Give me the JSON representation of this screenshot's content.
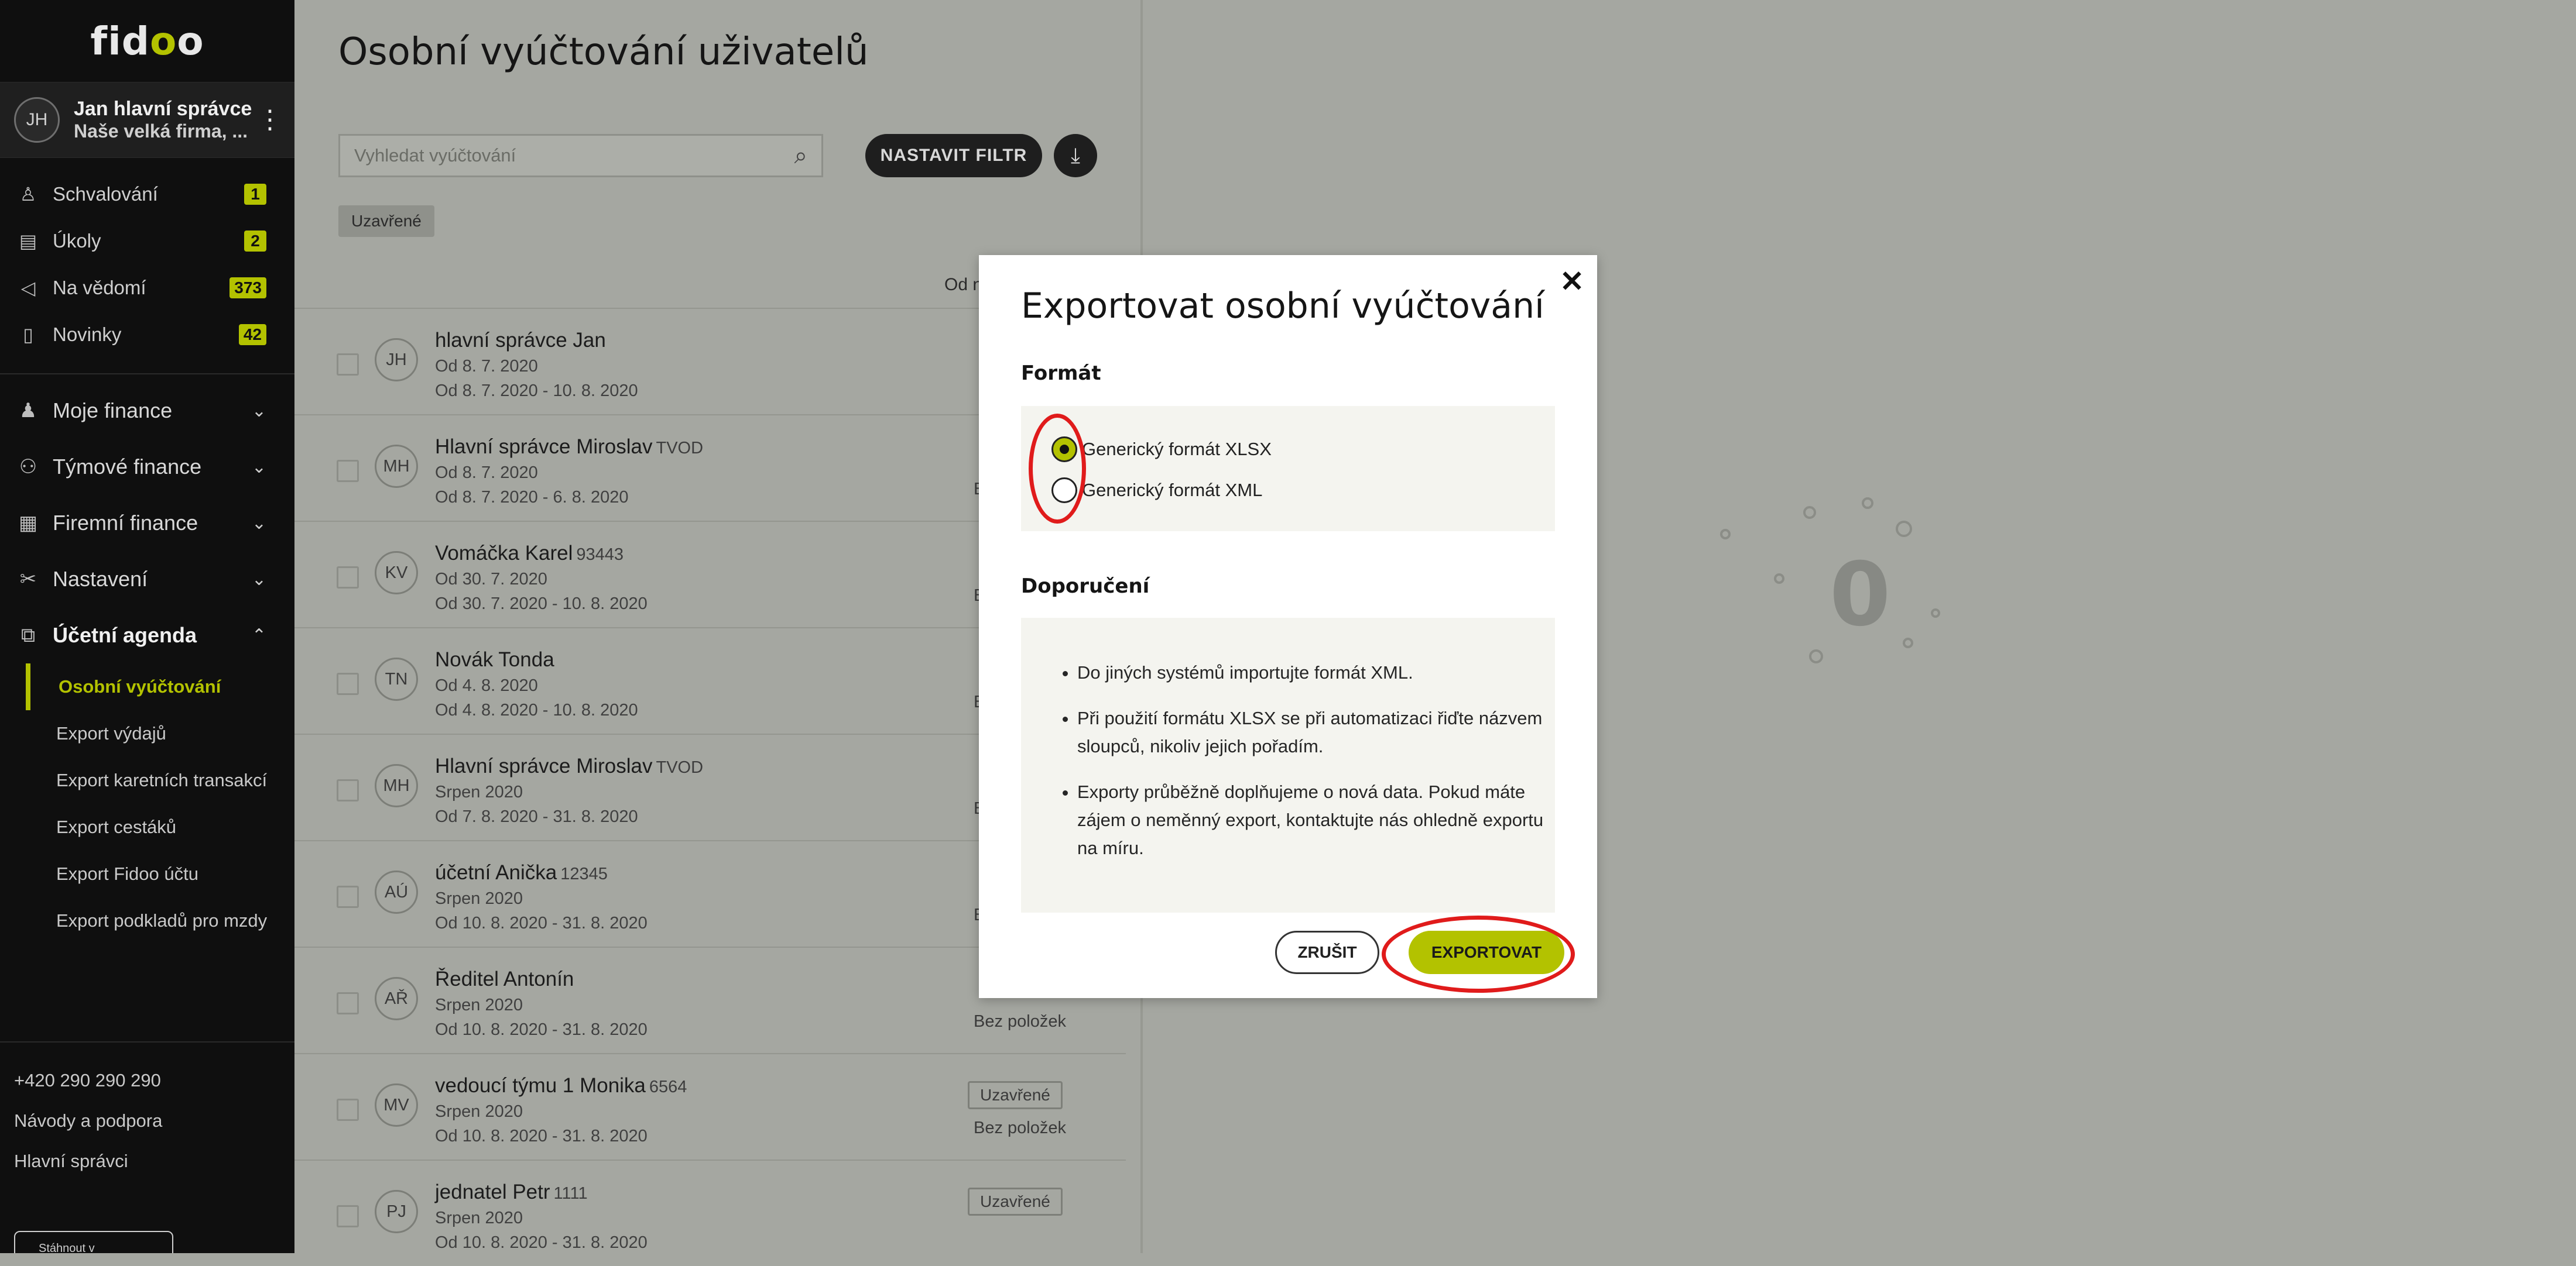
{
  "app": {
    "logo_prefix": "fid",
    "logo_accent": "o",
    "logo_suffix": "o"
  },
  "user": {
    "initials": "JH",
    "name": "Jan hlavní správce",
    "company": "Naše velká firma, ..."
  },
  "nav_top": [
    {
      "label": "Schvalování",
      "badge": "1",
      "icon": "approval-icon"
    },
    {
      "label": "Úkoly",
      "badge": "2",
      "icon": "clipboard-icon"
    },
    {
      "label": "Na vědomí",
      "badge": "373",
      "icon": "megaphone-icon"
    },
    {
      "label": "Novinky",
      "badge": "42",
      "icon": "news-icon"
    }
  ],
  "sections": [
    {
      "label": "Moje finance",
      "icon": "person-icon"
    },
    {
      "label": "Týmové finance",
      "icon": "team-icon"
    },
    {
      "label": "Firemní finance",
      "icon": "company-icon"
    },
    {
      "label": "Nastavení",
      "icon": "tools-icon"
    },
    {
      "label": "Účetní agenda",
      "icon": "accounting-icon"
    }
  ],
  "accounting_sub": [
    "Osobní vyúčtování",
    "Export výdajů",
    "Export karetních transakcí",
    "Export cestáků",
    "Export Fidoo účtu",
    "Export podkladů pro mzdy"
  ],
  "footer": {
    "phone": "+420 290 290 290",
    "help": "Návody a podpora",
    "admins": "Hlavní správci",
    "store": "Stáhnout v"
  },
  "list": {
    "title": "Osobní vyúčtování uživatelů",
    "search_placeholder": "Vyhledat vyúčtování",
    "filter_button": "NASTAVIT FILTR",
    "chip": "Uzavřené",
    "column_header": "Od n",
    "rows": [
      {
        "initials": "JH",
        "name": "hlavní správce Jan",
        "code": "",
        "line2": "Od 8. 7. 2020",
        "line3": "Od 8. 7. 2020 - 10. 8. 2020",
        "status": "",
        "items": ""
      },
      {
        "initials": "MH",
        "name": "Hlavní správce Miroslav",
        "code": "TVOD",
        "line2": "Od 8. 7. 2020",
        "line3": "Od 8. 7. 2020 - 6. 8. 2020",
        "status": "",
        "items": "B"
      },
      {
        "initials": "KV",
        "name": "Vomáčka Karel",
        "code": "93443",
        "line2": "Od 30. 7. 2020",
        "line3": "Od 30. 7. 2020 - 10. 8. 2020",
        "status": "",
        "items": "B"
      },
      {
        "initials": "TN",
        "name": "Novák Tonda",
        "code": "",
        "line2": "Od 4. 8. 2020",
        "line3": "Od 4. 8. 2020 - 10. 8. 2020",
        "status": "",
        "items": "B"
      },
      {
        "initials": "MH",
        "name": "Hlavní správce Miroslav",
        "code": "TVOD",
        "line2": "Srpen 2020",
        "line3": "Od 7. 8. 2020 - 31. 8. 2020",
        "status": "",
        "items": "B"
      },
      {
        "initials": "AÚ",
        "name": "účetní Anička",
        "code": "12345",
        "line2": "Srpen 2020",
        "line3": "Od 10. 8. 2020 - 31. 8. 2020",
        "status": "",
        "items": "B"
      },
      {
        "initials": "AŘ",
        "name": "Ředitel Antonín",
        "code": "",
        "line2": "Srpen 2020",
        "line3": "Od 10. 8. 2020 - 31. 8. 2020",
        "status": "",
        "items": "Bez položek"
      },
      {
        "initials": "MV",
        "name": "vedoucí týmu 1 Monika",
        "code": "6564",
        "line2": "Srpen 2020",
        "line3": "Od 10. 8. 2020 - 31. 8. 2020",
        "status": "Uzavřené",
        "items": "Bez položek"
      },
      {
        "initials": "PJ",
        "name": "jednatel Petr",
        "code": "1111",
        "line2": "Srpen 2020",
        "line3": "Od 10. 8. 2020 - 31. 8. 2020",
        "status": "Uzavřené",
        "items": ""
      }
    ]
  },
  "loader": {
    "glyph": "0"
  },
  "modal": {
    "title": "Exportovat osobní vyúčtování",
    "close": "✕",
    "format_heading": "Formát",
    "format_options": [
      {
        "label": "Generický formát XLSX",
        "selected": true
      },
      {
        "label": "Generický formát XML",
        "selected": false
      }
    ],
    "recommendation_heading": "Doporučení",
    "recommendations": [
      "Do jiných systémů importujte formát XML.",
      "Při použití formátu XLSX se při automatizaci řiďte názvem sloupců, nikoliv jejich pořadím.",
      "Exporty průběžně doplňujeme o nová data. Pokud máte zájem o neměnný export, kontaktujte nás ohledně exportu na míru."
    ],
    "cancel": "ZRUŠIT",
    "export": "EXPORTOVAT"
  },
  "colors": {
    "accent": "#b3c200",
    "annotation": "#e01b1b",
    "sidebar": "#0f0f0f"
  }
}
